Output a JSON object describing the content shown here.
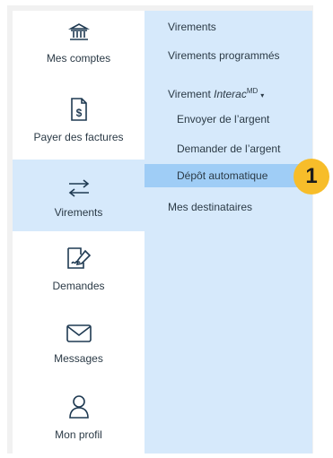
{
  "sidebar": {
    "items": [
      {
        "label": "Mes comptes",
        "icon": "bank-icon"
      },
      {
        "label": "Payer des factures",
        "icon": "bill-icon"
      },
      {
        "label": "Virements",
        "icon": "transfer-arrows-icon",
        "active": true
      },
      {
        "label": "Demandes",
        "icon": "signed-document-icon"
      },
      {
        "label": "Messages",
        "icon": "envelope-icon"
      },
      {
        "label": "Mon profil",
        "icon": "user-icon"
      }
    ]
  },
  "submenu": {
    "items": [
      {
        "label": "Virements"
      },
      {
        "label": "Virements programmés"
      },
      {
        "label_prefix": "Virement ",
        "label_italic": "Interac",
        "label_sup": "MD",
        "caret": "▾"
      },
      {
        "label": "Envoyer de l’argent"
      },
      {
        "label": "Demander de l’argent"
      },
      {
        "label": "Dépôt automatique",
        "selected": true
      },
      {
        "label": "Mes destinataires"
      }
    ]
  },
  "callout": {
    "number": "1"
  },
  "colors": {
    "active_bg": "#d6e9fb",
    "selected_bg": "#9fcdf6",
    "badge": "#f7bd2a"
  }
}
